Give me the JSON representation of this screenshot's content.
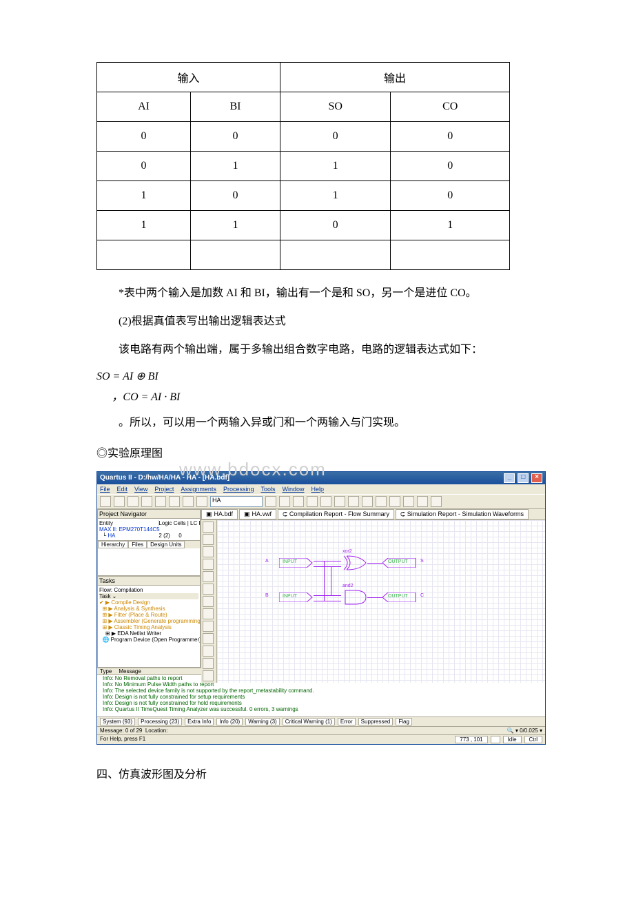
{
  "truth_table": {
    "header_groups": {
      "in": "输入",
      "out": "输出"
    },
    "cols": {
      "c1": "AI",
      "c2": "BI",
      "c3": "SO",
      "c4": "CO"
    },
    "rows": [
      {
        "c1": "0",
        "c2": "0",
        "c3": "0",
        "c4": "0"
      },
      {
        "c1": "0",
        "c2": "1",
        "c3": "1",
        "c4": "0"
      },
      {
        "c1": "1",
        "c2": "0",
        "c3": "1",
        "c4": "0"
      },
      {
        "c1": "1",
        "c2": "1",
        "c3": "0",
        "c4": "1"
      },
      {
        "c1": "",
        "c2": "",
        "c3": "",
        "c4": ""
      }
    ]
  },
  "text": {
    "note": "*表中两个输入是加数 AI 和 BI，输出有一个是和 SO，另一个是进位 CO。",
    "step2": "(2)根据真值表写出输出逻辑表达式",
    "explain": "该电路有两个输出端，属于多输出组合数字电路，电路的逻辑表达式如下：",
    "formula1": "SO = AI ⊕ BI",
    "formula2": "，CO = AI · BI",
    "conclude": "。所以，可以用一个两输入异或门和一个两输入与门实现。",
    "fig_title": "◎实验原理图",
    "section4": "四、仿真波形图及分析"
  },
  "app": {
    "title": "Quartus II - D:/hw/HA/HA - HA - [HA.bdf]",
    "menu": [
      "File",
      "Edit",
      "View",
      "Project",
      "Assignments",
      "Processing",
      "Tools",
      "Window",
      "Help"
    ],
    "selector": "HA",
    "proj_nav": "Project Navigator",
    "entity": "Entity",
    "cols": "Logic Cells | LC Register",
    "device_line": "MAX II: EPM270T144C5",
    "device_sub": "HA",
    "device_cells": "2 (2)",
    "device_regs": "0",
    "nav_tabs": [
      "Hierarchy",
      "Files",
      "Design Units"
    ],
    "tasks": "Tasks",
    "flow": "Flow: Compilation",
    "task_hdr": "Task ⌄",
    "task_items": [
      "Compile Design",
      "Analysis & Synthesis",
      "Fitter (Place & Route)",
      "Assembler (Generate programming files)",
      "Classic Timing Analysis",
      "EDA Netlist Writer",
      "Program Device (Open Programmer)"
    ],
    "canvas_tabs": [
      "HA.bdf",
      "HA.vwf",
      "Compilation Report - Flow Summary",
      "Simulation Report - Simulation Waveforms"
    ],
    "schem": {
      "a": "A",
      "b": "B",
      "so": "S",
      "co": "C",
      "xor": "xor2",
      "and": "and2",
      "ip1": "INPUT",
      "ip2": "INPUT",
      "op1": "OUTPUT",
      "op2": "OUTPUT"
    },
    "msg_cols": [
      "Type",
      "Message"
    ],
    "messages": [
      "Info: No Removal paths to report",
      "Info: No Minimum Pulse Width paths to report",
      "Info: The selected device family is not supported by the report_metastability command.",
      "Info: Design is not fully constrained for setup requirements",
      "Info: Design is not fully constrained for hold requirements",
      "Info: Quartus II TimeQuest Timing Analyzer was successful. 0 errors, 3 warnings"
    ],
    "msg_tabs": [
      "System (93)",
      "Processing (23)",
      "Extra Info",
      "Info (20)",
      "Warning (3)",
      "Critical Warning (1)",
      "Error",
      "Suppressed",
      "Flag"
    ],
    "msg_status": "Message: 0 of 29",
    "msg_loc": "Location:",
    "help": "For Help, press F1",
    "status_cells": [
      "773 , 101",
      "",
      "Idle",
      "Ctrl"
    ],
    "search": "🔍 ▾ 0/0.025 ▾",
    "watermark": "www.bdocx.com"
  }
}
